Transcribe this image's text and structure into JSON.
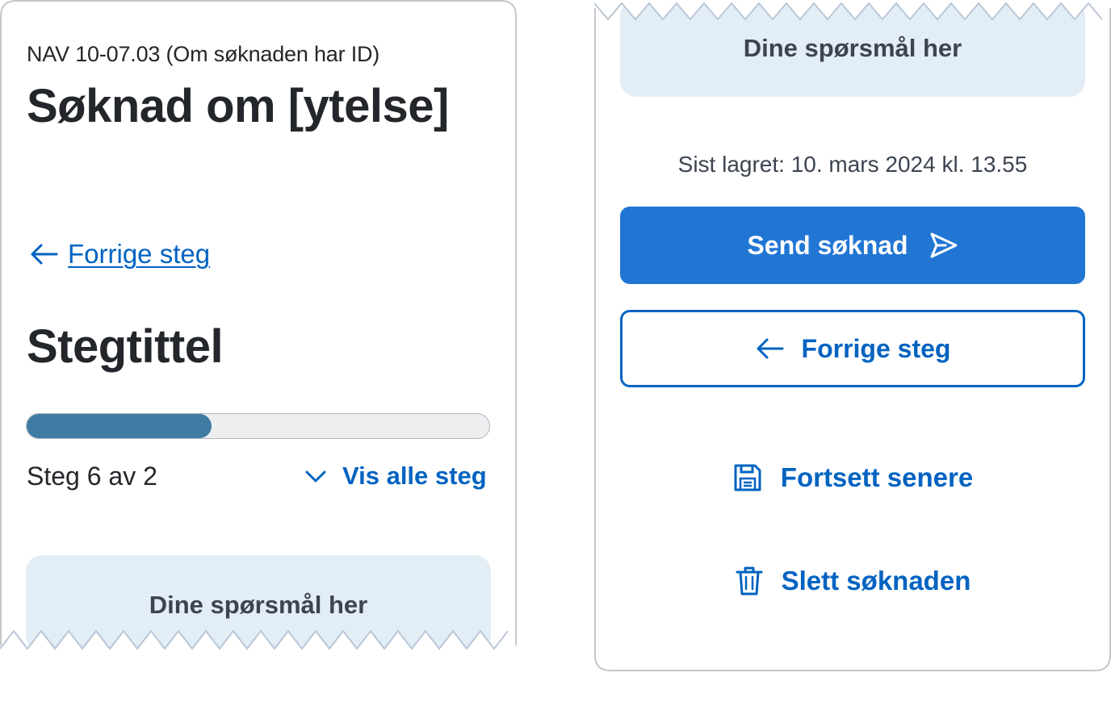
{
  "form": {
    "id_line": "NAV 10-07.03 (Om søknaden har ID)",
    "title": "Søknad om [ytelse]"
  },
  "navigation": {
    "back_link": "Forrige steg"
  },
  "step": {
    "title": "Stegtittel",
    "counter": "Steg 6 av 2",
    "show_all": "Vis alle steg",
    "progress_fraction": 0.4
  },
  "questions": {
    "placeholder": "Dine spørsmål her"
  },
  "footer": {
    "last_saved": "Sist lagret: 10. mars 2024 kl. 13.55",
    "send_button": "Send søknad",
    "previous_button": "Forrige steg",
    "continue_later": "Fortsett senere",
    "delete": "Slett søknaden"
  },
  "colors": {
    "accent": "#0063c1",
    "primary_button": "#2176d4",
    "progress_fill": "#3f7ba3",
    "question_bg": "#e2edf6",
    "text": "#23262a"
  },
  "icons": {
    "back": "arrow-left-icon",
    "expand": "chevron-down-icon",
    "send": "paper-plane-icon",
    "save": "floppy-disk-icon",
    "delete": "trash-icon"
  }
}
